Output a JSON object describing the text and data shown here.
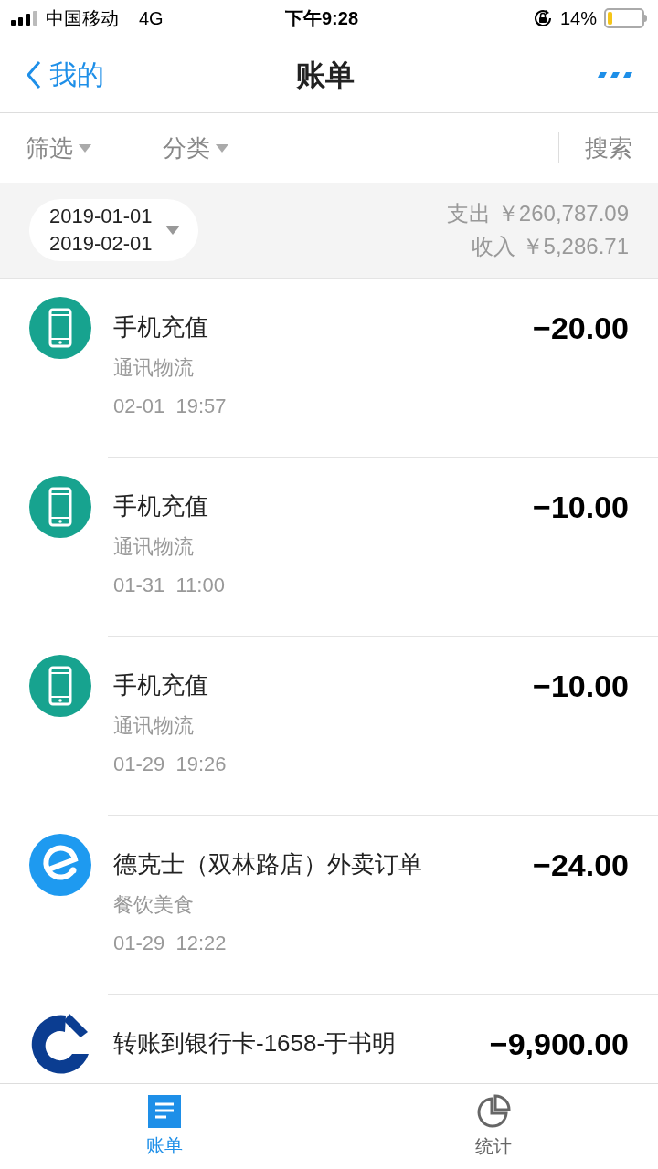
{
  "status_bar": {
    "carrier": "中国移动",
    "network": "4G",
    "time": "下午9:28",
    "battery": "14%"
  },
  "nav": {
    "back": "我的",
    "title": "账单"
  },
  "filters": [
    {
      "label": "筛选"
    },
    {
      "label": "分类"
    }
  ],
  "search": "搜索",
  "period": {
    "start": "2019-01-01",
    "end": "2019-02-01"
  },
  "summary": [
    {
      "label": "支出",
      "value": "￥260,787.09"
    },
    {
      "label": "收入",
      "value": "￥5,286.71"
    }
  ],
  "transactions": [
    {
      "kind": "phone",
      "title": "手机充值",
      "category": "通讯物流",
      "time": "02-01  19:57",
      "amount": "−20.00"
    },
    {
      "kind": "phone",
      "title": "手机充值",
      "category": "通讯物流",
      "time": "01-31  11:00",
      "amount": "−10.00"
    },
    {
      "kind": "phone",
      "title": "手机充值",
      "category": "通讯物流",
      "time": "01-29  19:26",
      "amount": "−10.00"
    },
    {
      "kind": "delivery",
      "title": "德克士（双林路店）外卖订单",
      "category": "餐饮美食",
      "time": "01-29  12:22",
      "amount": "−24.00"
    },
    {
      "kind": "bank",
      "title": "转账到银行卡-1658-于书明",
      "amount": "−9,900.00"
    }
  ],
  "tabs": [
    {
      "label": "账单",
      "selected": true
    },
    {
      "label": "统计",
      "selected": false
    }
  ]
}
